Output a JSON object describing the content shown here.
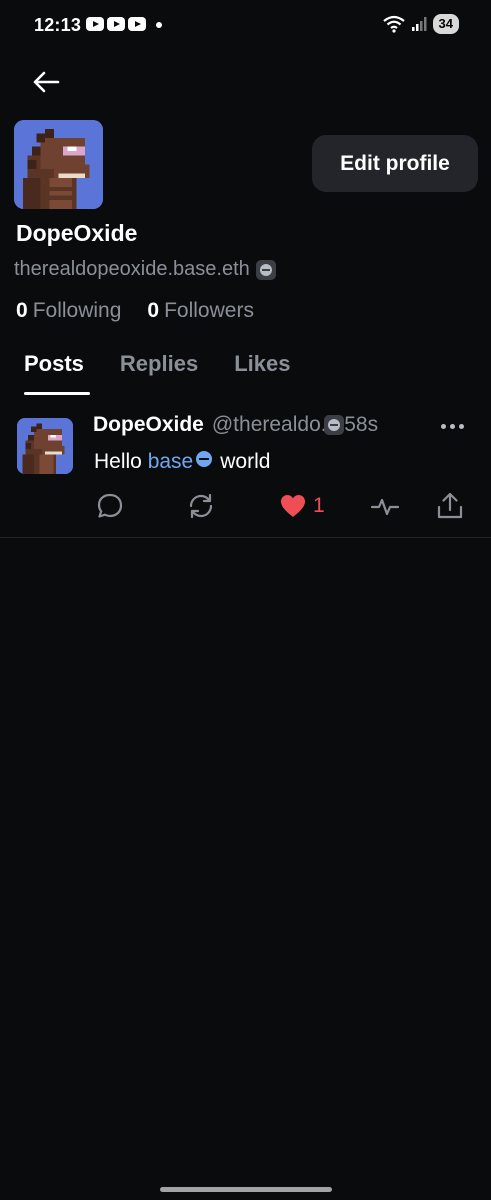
{
  "status_bar": {
    "time": "12:13",
    "battery": "34"
  },
  "profile": {
    "display_name": "DopeOxide",
    "handle": "therealdopeoxide.base.eth",
    "following_count": "0",
    "following_label": "Following",
    "followers_count": "0",
    "followers_label": "Followers",
    "edit_button": "Edit profile"
  },
  "tabs": [
    {
      "label": "Posts",
      "active": true
    },
    {
      "label": "Replies",
      "active": false
    },
    {
      "label": "Likes",
      "active": false
    }
  ],
  "post": {
    "author": "DopeOxide",
    "handle": "@therealdo...",
    "time": "58s",
    "text_before": "Hello",
    "mention": "base",
    "text_after": "world",
    "like_count": "1"
  },
  "icons": [
    "back-arrow-icon",
    "more-icon",
    "reply-icon",
    "recast-icon",
    "heart-icon",
    "activity-icon",
    "share-icon",
    "base-badge-icon",
    "wifi-icon",
    "signal-icon"
  ],
  "colors": {
    "background": "#0a0b0d",
    "button_bg": "#23252b",
    "muted_text": "#8a8f98",
    "mention": "#6fa8f0",
    "like": "#ef4e55"
  }
}
